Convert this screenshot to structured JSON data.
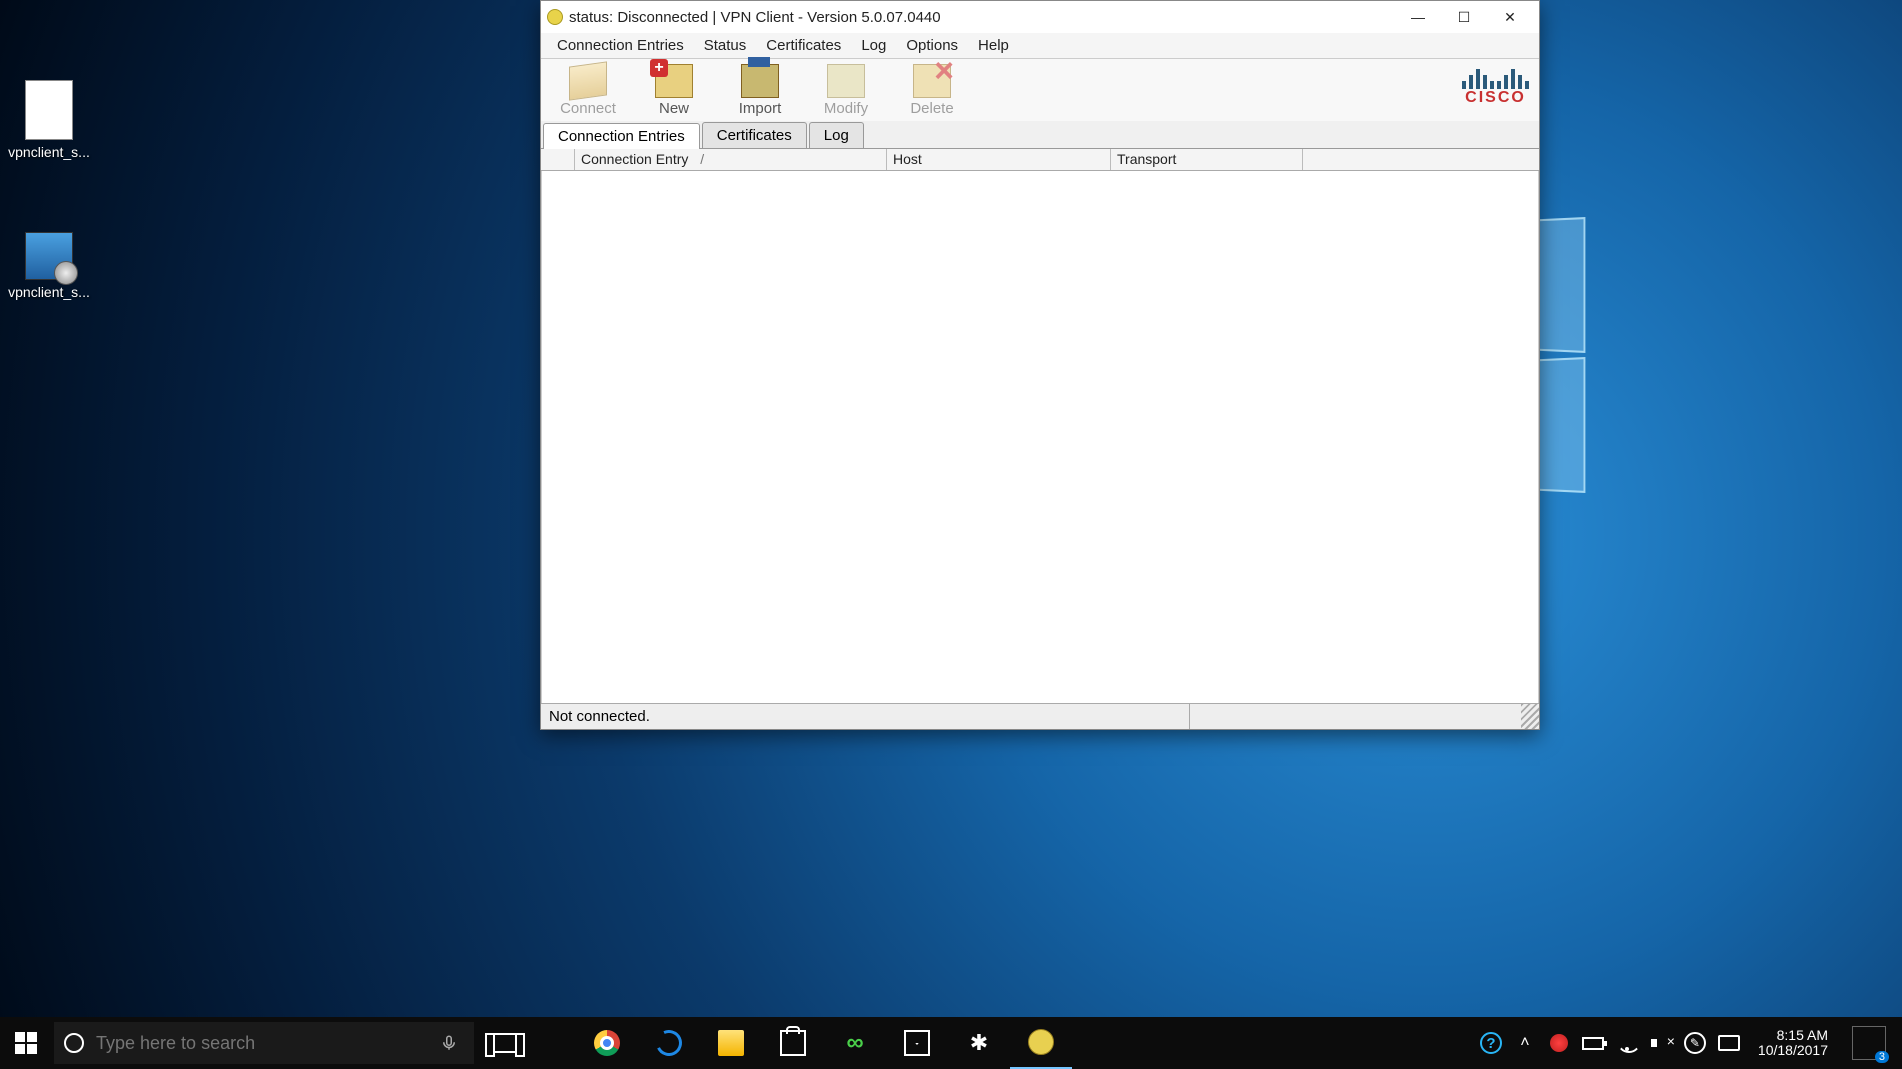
{
  "desktop": {
    "icon1": "vpnclient_s...",
    "icon2": "vpnclient_s..."
  },
  "window": {
    "title": "status: Disconnected | VPN Client - Version 5.0.07.0440",
    "menu": {
      "m1": "Connection Entries",
      "m2": "Status",
      "m3": "Certificates",
      "m4": "Log",
      "m5": "Options",
      "m6": "Help"
    },
    "toolbar": {
      "connect": "Connect",
      "new": "New",
      "import": "Import",
      "modify": "Modify",
      "delete": "Delete"
    },
    "brand": "CISCO",
    "tabs": {
      "t1": "Connection Entries",
      "t2": "Certificates",
      "t3": "Log"
    },
    "columns": {
      "c1": "Connection Entry",
      "sort": "/",
      "c2": "Host",
      "c3": "Transport"
    },
    "status": "Not connected."
  },
  "taskbar": {
    "search_placeholder": "Type here to search",
    "time": "8:15 AM",
    "date": "10/18/2017",
    "notif_count": "3"
  }
}
